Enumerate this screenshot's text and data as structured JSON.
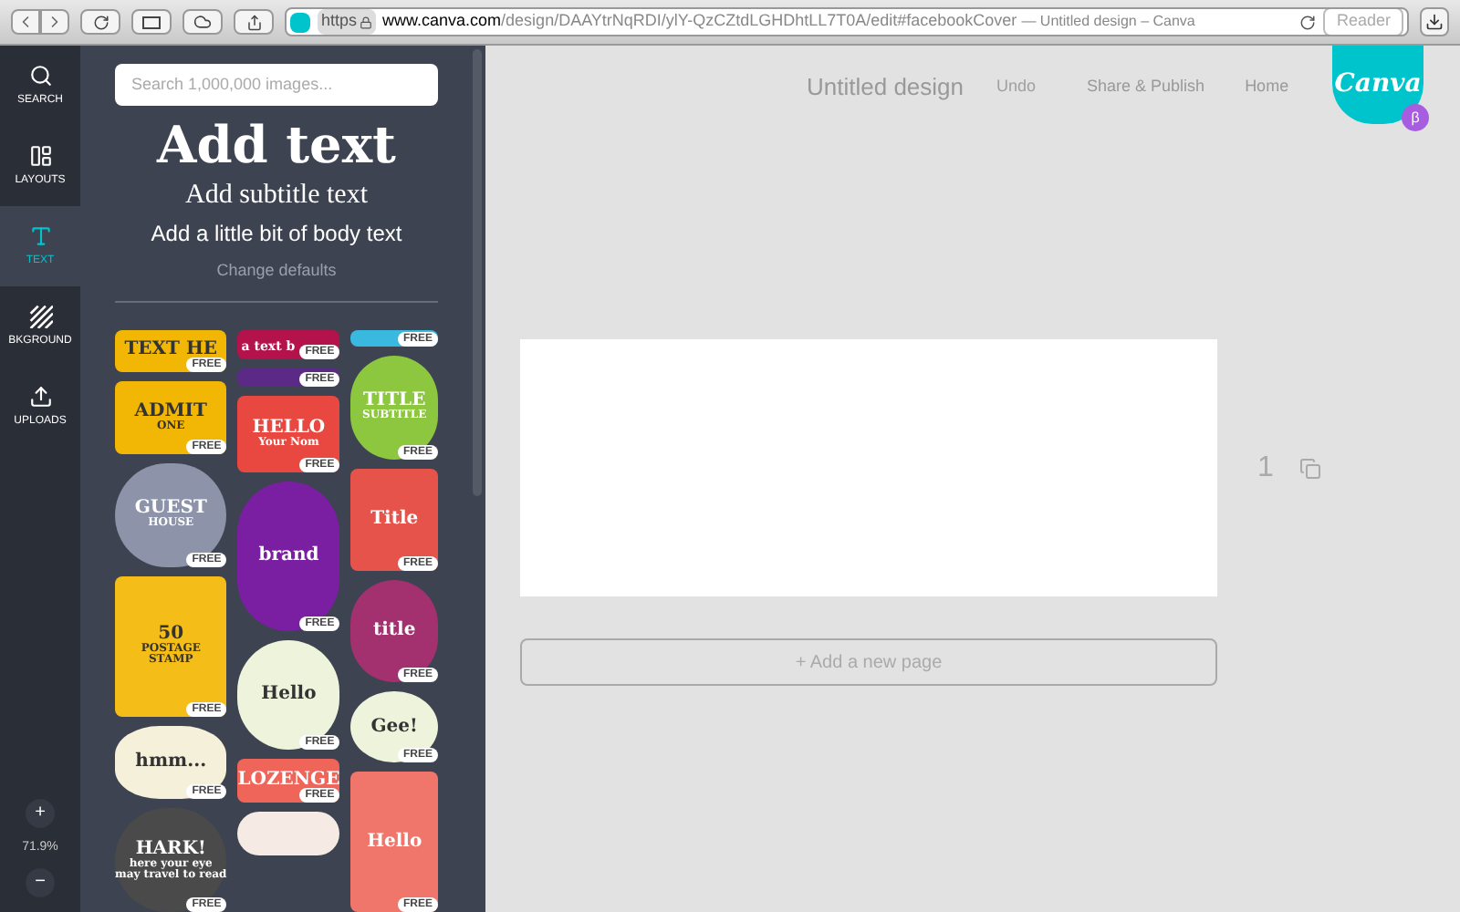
{
  "browser": {
    "url_scheme": "https",
    "url_host": "www.canva.com",
    "url_path": "/design/DAAYtrNqRDI/ylY-QzCZtdLGHDhtLL7T0A/edit#facebookCover",
    "page_title": "— Untitled design – Canva",
    "reader": "Reader"
  },
  "sidebar": {
    "items": [
      {
        "label": "SEARCH",
        "kind": "search",
        "selected": false
      },
      {
        "label": "LAYOUTS",
        "kind": "layouts",
        "selected": false
      },
      {
        "label": "TEXT",
        "kind": "text",
        "selected": true
      },
      {
        "label": "BKGROUND",
        "kind": "background",
        "selected": false
      },
      {
        "label": "UPLOADS",
        "kind": "uploads",
        "selected": false
      }
    ],
    "zoom_in": "+",
    "zoom": "71.9%",
    "zoom_out": "−"
  },
  "panel": {
    "search": {
      "placeholder": "Search 1,000,000 images..."
    },
    "heading": "Add text",
    "subheading": "Add subtitle text",
    "body": "Add a little bit of body text",
    "change_defaults": "Change defaults",
    "stickers": [
      [
        {
          "kind": "rect",
          "color": "#f2b705",
          "lines": [
            "TEXT HE"
          ],
          "badge": "FREE"
        },
        {
          "kind": "rect",
          "color": "#f2b705",
          "lines": [
            "ADMIT",
            "ONE"
          ],
          "badge": "FREE"
        },
        {
          "kind": "circle",
          "color": "#8d93a8",
          "lines": [
            "GUEST",
            "HOUSE"
          ],
          "badge": "FREE"
        },
        {
          "kind": "rect",
          "color": "#f5bd17",
          "lines": [
            "50",
            "POSTAGE",
            "STAMP"
          ],
          "badge": "FREE"
        },
        {
          "kind": "cloud",
          "color": "#f4f0da",
          "lines": [
            "hmm..."
          ],
          "badge": "FREE"
        },
        {
          "kind": "circle",
          "color": "#4a4a4a",
          "lines": [
            "HARK!",
            "here your eye",
            "may travel to read"
          ],
          "badge": "FREE"
        }
      ],
      [
        {
          "kind": "rect",
          "color": "#b3134a",
          "lines": [
            "a text b"
          ],
          "badge": "FREE"
        },
        {
          "kind": "rect",
          "color": "#5b2a86",
          "badge": "FREE"
        },
        {
          "kind": "rect",
          "color": "#e8483f",
          "lines": [
            "HELLO",
            "Your Nom"
          ],
          "badge": "FREE"
        },
        {
          "kind": "circle",
          "color": "#7b1fa2",
          "lines": [
            "brand"
          ],
          "badge": "FREE"
        },
        {
          "kind": "circle",
          "color": "#eef3dc",
          "lines": [
            "Hello"
          ],
          "badge": "FREE"
        },
        {
          "kind": "rect",
          "color": "#f0655a",
          "lines": [
            "LOZENGE"
          ],
          "badge": "FREE"
        },
        {
          "kind": "circle",
          "color": "#f5ebe4"
        }
      ],
      [
        {
          "kind": "rect",
          "color": "#39b9e0",
          "badge": "FREE"
        },
        {
          "kind": "circle",
          "color": "#8dc63f",
          "lines": [
            "TITLE",
            "SUBTITLE"
          ],
          "badge": "FREE"
        },
        {
          "kind": "rect",
          "color": "#e5534b",
          "lines": [
            "Title"
          ],
          "badge": "FREE"
        },
        {
          "kind": "circle",
          "color": "#a3306f",
          "lines": [
            "title"
          ],
          "badge": "FREE"
        },
        {
          "kind": "oval",
          "color": "#eef3dc",
          "lines": [
            "Gee!"
          ],
          "badge": "FREE"
        },
        {
          "kind": "rect",
          "color": "#f0756a",
          "lines": [
            "Hello"
          ],
          "badge": "FREE"
        }
      ]
    ]
  },
  "header": {
    "title": "Untitled design",
    "undo": "Undo",
    "share": "Share & Publish",
    "home": "Home",
    "logo": "Canva",
    "beta": "β"
  },
  "canvas": {
    "page_number": "1",
    "add_page": "+ Add a new page"
  }
}
